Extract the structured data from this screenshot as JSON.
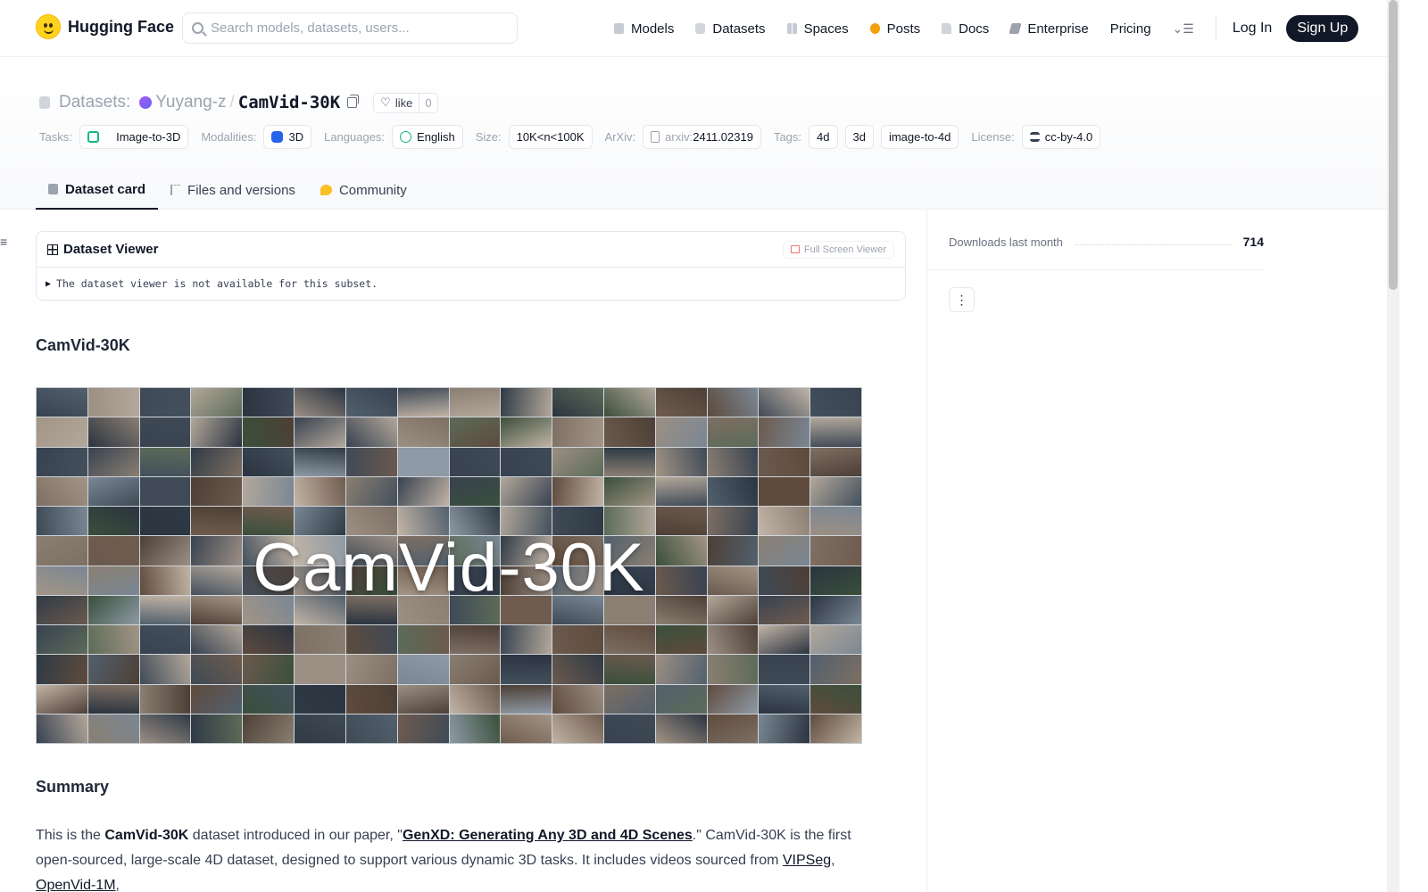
{
  "nav": {
    "brand": "Hugging Face",
    "search_placeholder": "Search models, datasets, users...",
    "links": {
      "models": "Models",
      "datasets": "Datasets",
      "spaces": "Spaces",
      "posts": "Posts",
      "docs": "Docs",
      "enterprise": "Enterprise",
      "pricing": "Pricing"
    },
    "login": "Log In",
    "signup": "Sign Up"
  },
  "header": {
    "section": "Datasets:",
    "owner": "Yuyang-z",
    "separator": "/",
    "repo": "CamVid-30K",
    "like_label": "like",
    "like_count": "0"
  },
  "tags": {
    "tasks_label": "Tasks:",
    "task": "Image-to-3D",
    "modalities_label": "Modalities:",
    "modality": "3D",
    "languages_label": "Languages:",
    "language": "English",
    "size_label": "Size:",
    "size": "10K<n<100K",
    "arxiv_label": "ArXiv:",
    "arxiv_prefix": "arxiv:",
    "arxiv_id": "2411.02319",
    "tags_label": "Tags:",
    "tag_list": [
      "4d",
      "3d",
      "image-to-4d"
    ],
    "license_label": "License:",
    "license": "cc-by-4.0"
  },
  "tabs": {
    "card": "Dataset card",
    "files": "Files and versions",
    "community": "Community"
  },
  "viewer": {
    "title": "Dataset Viewer",
    "fullscreen": "Full Screen Viewer",
    "message": "The dataset viewer is not available for this subset."
  },
  "content": {
    "heading": "CamVid-30K",
    "image_title": "CamVid-30K",
    "summary_heading": "Summary",
    "para": {
      "p1": "This is the ",
      "b1": "CamVid-30K",
      "p2": " dataset introduced in our paper, \"",
      "link_paper": "GenXD: Generating Any 3D and 4D Scenes",
      "p3": ".\" CamVid-30K is the first open-sourced, large-scale 4D dataset, designed to support various dynamic 3D tasks. It includes videos sourced from ",
      "link1": "VIPSeg",
      "sep1": ", ",
      "link2": "OpenVid-1M",
      "p4": ","
    }
  },
  "sidebar": {
    "downloads_label": "Downloads last month",
    "downloads_value": "714"
  },
  "icons": {
    "brand": "hugging-face-emoji-icon",
    "search": "search-icon",
    "like": "heart-icon",
    "copy": "copy-icon",
    "menu": "more-menu-icon"
  }
}
